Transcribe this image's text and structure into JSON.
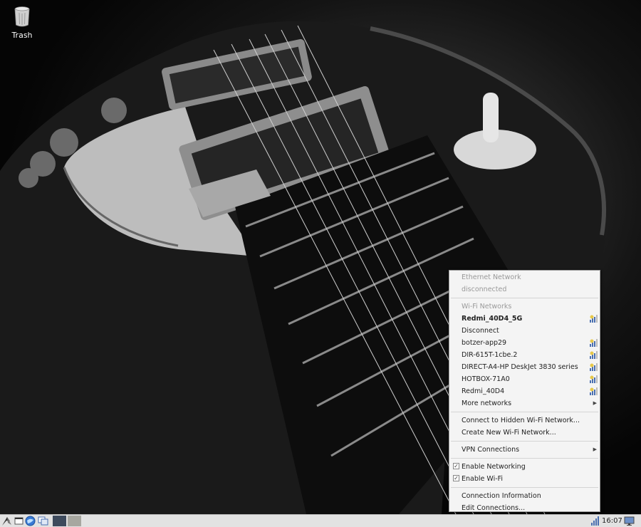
{
  "desktop": {
    "icons": [
      {
        "label": "Trash",
        "icon": "trash-icon"
      }
    ]
  },
  "network_menu": {
    "ethernet_header": "Ethernet Network",
    "ethernet_status": "disconnected",
    "wifi_header": "Wi-Fi Networks",
    "connected_network": "Redmi_40D4_5G",
    "disconnect_label": "Disconnect",
    "networks": [
      "botzer-app29",
      "DIR-615T-1cbe.2",
      "DIRECT-A4-HP DeskJet 3830 series",
      "HOTBOX-71A0",
      "Redmi_40D4"
    ],
    "more_networks": "More networks",
    "connect_hidden": "Connect to Hidden Wi-Fi Network...",
    "create_new": "Create New Wi-Fi Network...",
    "vpn": "VPN Connections",
    "enable_networking": "Enable Networking",
    "enable_networking_checked": true,
    "enable_wifi": "Enable Wi-Fi",
    "enable_wifi_checked": true,
    "connection_info": "Connection Information",
    "edit_connections": "Edit Connections..."
  },
  "taskbar": {
    "clock": "16:07",
    "launchers": [
      "start-menu-icon",
      "show-desktop-icon",
      "browser-icon",
      "window-switcher-icon"
    ],
    "workspaces": [
      "workspace-1",
      "workspace-2"
    ],
    "tray": [
      "network-signal-icon",
      "monitor-icon"
    ]
  }
}
